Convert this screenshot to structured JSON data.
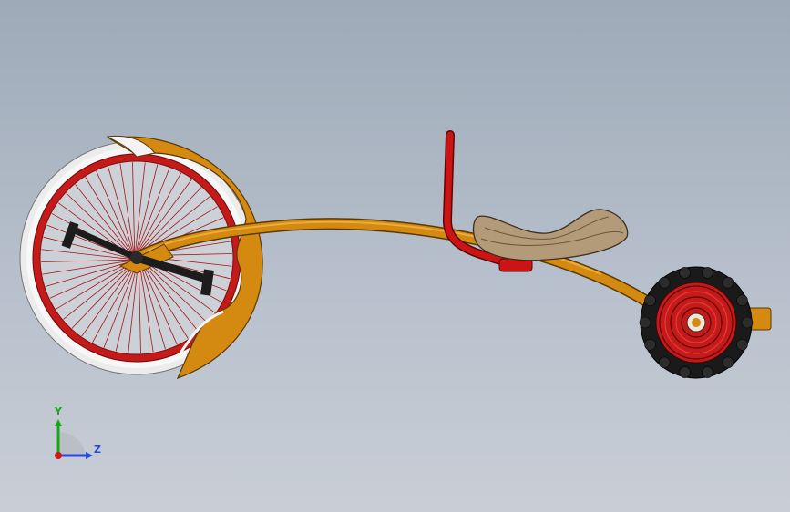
{
  "viewport": {
    "background_top": "#9eaab8",
    "background_bottom": "#c9ced6"
  },
  "model": {
    "frame_color": "#d48a10",
    "frame_shadow": "#9a5e05",
    "handlebar_color": "#cc1414",
    "seat_color": "#b39a78",
    "rim_color": "#c41a1a",
    "spoke_color": "#a41515",
    "tire_color": "#f0f0f0",
    "rear_tire_color": "#1a1a1a",
    "crank_color": "#1c1c1c"
  },
  "triad": {
    "y_label": "Y",
    "z_label": "Z",
    "y_color": "#1aa61a",
    "z_color": "#2a49d6",
    "origin_color": "#d01818"
  }
}
